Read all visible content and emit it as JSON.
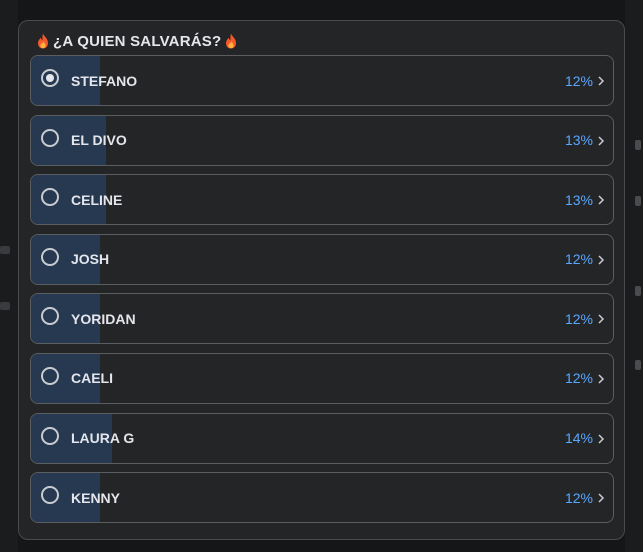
{
  "poll": {
    "title": "¿A QUIEN SALVARÁS?",
    "title_icon": "flame-icon",
    "accent_color": "#5aa7ff",
    "fill_color": "#263951",
    "options": [
      {
        "label": "STEFANO",
        "percent": 12,
        "percent_text": "12%",
        "selected": true
      },
      {
        "label": "EL DIVO",
        "percent": 13,
        "percent_text": "13%",
        "selected": false
      },
      {
        "label": "CELINE",
        "percent": 13,
        "percent_text": "13%",
        "selected": false
      },
      {
        "label": "JOSH",
        "percent": 12,
        "percent_text": "12%",
        "selected": false
      },
      {
        "label": "YORIDAN",
        "percent": 12,
        "percent_text": "12%",
        "selected": false
      },
      {
        "label": "CAELI",
        "percent": 12,
        "percent_text": "12%",
        "selected": false
      },
      {
        "label": "LAURA G",
        "percent": 14,
        "percent_text": "14%",
        "selected": false
      },
      {
        "label": "KENNY",
        "percent": 12,
        "percent_text": "12%",
        "selected": false
      }
    ]
  }
}
